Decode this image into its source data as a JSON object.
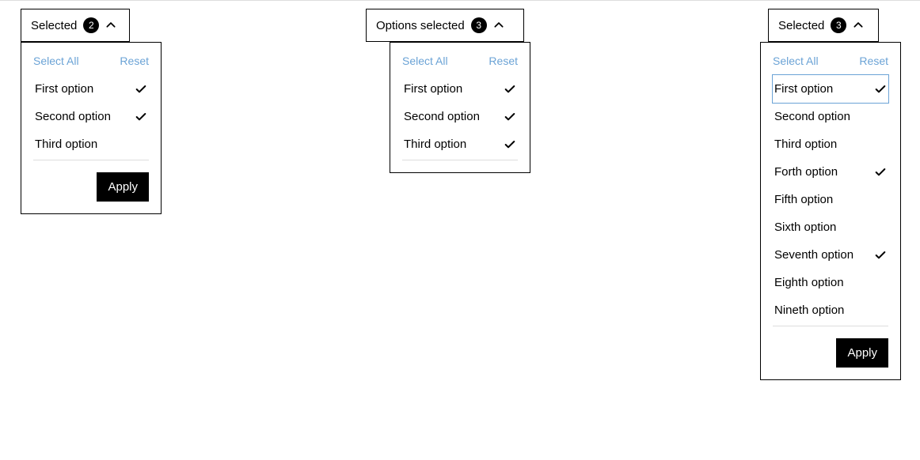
{
  "common": {
    "select_all": "Select All",
    "reset": "Reset",
    "apply": "Apply"
  },
  "dropdown1": {
    "label": "Selected",
    "count": "2",
    "options": [
      {
        "label": "First option",
        "checked": true
      },
      {
        "label": "Second option",
        "checked": true
      },
      {
        "label": "Third option",
        "checked": false
      }
    ]
  },
  "dropdown2": {
    "label": "Options selected",
    "count": "3",
    "options": [
      {
        "label": "First option",
        "checked": true
      },
      {
        "label": "Second option",
        "checked": true
      },
      {
        "label": "Third option",
        "checked": true
      }
    ]
  },
  "dropdown3": {
    "label": "Selected",
    "count": "3",
    "options": [
      {
        "label": "First option",
        "checked": true,
        "highlighted": true
      },
      {
        "label": "Second option",
        "checked": false
      },
      {
        "label": "Third option",
        "checked": false
      },
      {
        "label": "Forth option",
        "checked": true
      },
      {
        "label": "Fifth option",
        "checked": false
      },
      {
        "label": "Sixth option",
        "checked": false
      },
      {
        "label": "Seventh option",
        "checked": true
      },
      {
        "label": "Eighth option",
        "checked": false
      },
      {
        "label": "Nineth option",
        "checked": false
      }
    ]
  }
}
